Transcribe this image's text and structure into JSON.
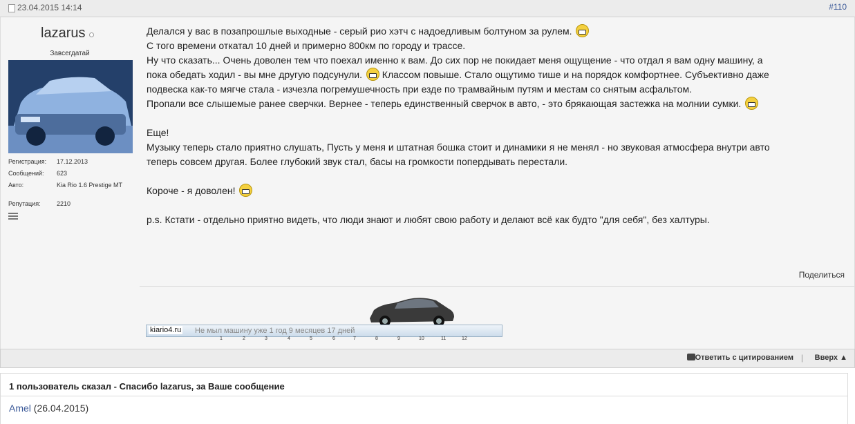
{
  "header": {
    "date": "23.04.2015 14:14",
    "post_number": "#110"
  },
  "user": {
    "name": "lazarus",
    "title": "Завсегдатай",
    "info": [
      {
        "label": "Регистрация:",
        "value": "17.12.2013"
      },
      {
        "label": "Сообщений:",
        "value": "623"
      },
      {
        "label": "Авто:",
        "value": "Kia Rio 1.6 Prestige MT"
      },
      {
        "label": "Репутация:",
        "value": "2210"
      }
    ]
  },
  "message": {
    "lines": [
      "Делался у вас в позапрошлые выходные - серый рио хэтч с надоедливым болтуном за рулем.",
      "С того времени откатал 10 дней и примерно 800км по городу и трассе.",
      "Ну что сказать... Очень доволен тем что поехал именно к вам. До сих пор не покидает меня ощущение - что отдал я вам одну машину, а",
      "пока обедать ходил - вы мне другую подсунули.",
      "Классом повыше. Стало ощутимо тише и на порядок комфортнее. Субъективно даже",
      "подвеска как-то мягче стала - изчезла погремушечность при езде по трамвайным путям и местам со снятым асфальтом.",
      "Пропали все слышемые ранее сверчки. Вернее - теперь единственный сверчок в авто, - это брякающая застежка на молнии сумки.",
      "Еще!",
      "Музыку теперь стало приятно слушать, Пусть у меня и штатная бошка стоит и динамики я не менял - но звуковая атмосфера внутри авто",
      "теперь совсем другая. Более глубокий звук стал, басы на громкости попердывать перестали.",
      "Короче - я доволен!",
      "p.s. Кстати - отдельно приятно видеть, что люди знают и любят свою работу и делают всё как будто \"для себя\", без халтуры."
    ]
  },
  "share_label": "Поделиться",
  "signature": {
    "site": "kiario4.ru",
    "text": "Не мыл машину уже 1 год 9 месяцев 17 дней",
    "scale": [
      "1",
      "2",
      "3",
      "4",
      "5",
      "6",
      "7",
      "8",
      "9",
      "10",
      "11",
      "12"
    ]
  },
  "footer": {
    "quote_label": "Ответить с цитированием",
    "separator": "|",
    "up_label": "Вверх ▲"
  },
  "thanks": {
    "header": "1 пользователь сказал - Спасибо lazarus, за Ваше сообщение",
    "user": "Amel",
    "date": "(26.04.2015)"
  },
  "colors": {
    "link": "#3b5998",
    "header_bg": "#ececec",
    "post_bg": "#f5f5f5"
  },
  "icons": [
    "document-icon",
    "online-status-icon",
    "menu-icon",
    "smile-icon",
    "quote-icon"
  ]
}
